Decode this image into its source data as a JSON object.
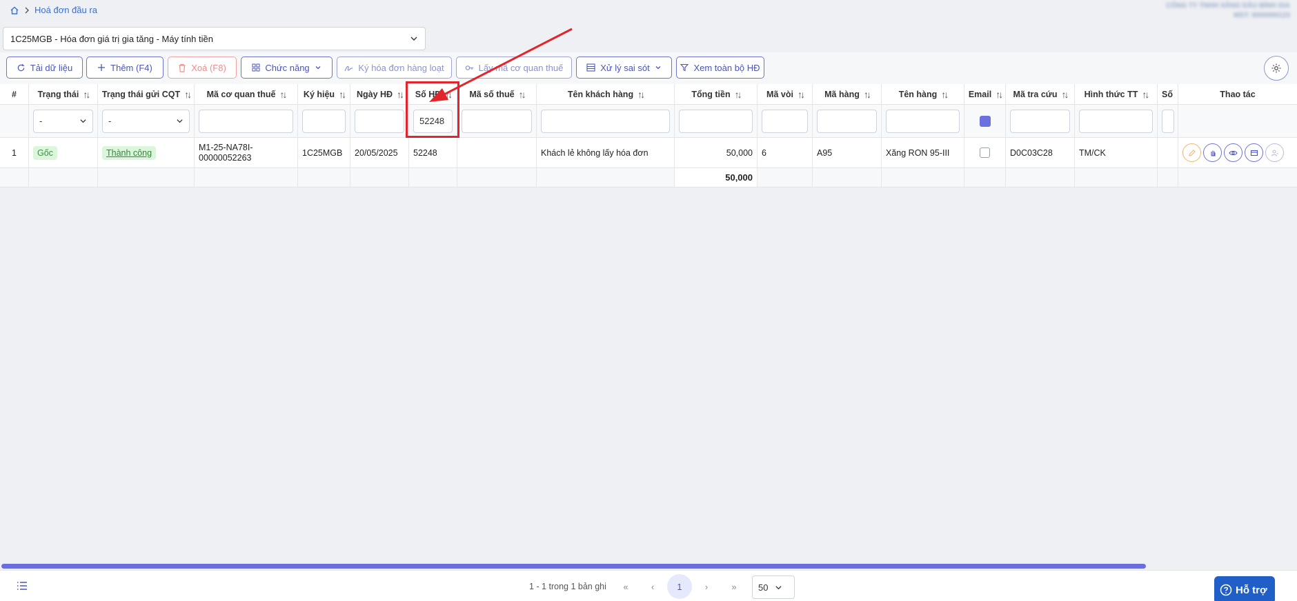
{
  "breadcrumb": {
    "page": "Hoá đơn đầu ra"
  },
  "company": {
    "line1": "CÔNG TY TNHH XĂNG DẦU BÌNH GIA",
    "line2": "MST: 0000000123"
  },
  "series_select": {
    "value": "1C25MGB - Hóa đơn giá trị gia tăng - Máy tính tiền"
  },
  "toolbar": {
    "reload": "Tải dữ liệu",
    "add": "Thêm (F4)",
    "delete": "Xoá (F8)",
    "functions": "Chức năng",
    "bulk_sign": "Ký hóa đơn hàng loạt",
    "get_tax_code": "Lấy mã cơ quan thuế",
    "handle_errors": "Xử lý sai sót",
    "view_all": "Xem toàn bộ HĐ"
  },
  "columns": {
    "index": "#",
    "status": "Trạng thái",
    "send_status": "Trạng thái gửi CQT",
    "tax_authority_code": "Mã cơ quan thuế",
    "symbol": "Ký hiệu",
    "date": "Ngày HĐ",
    "invoice_no": "Số HĐ",
    "tax_id": "Mã số thuế",
    "customer_name": "Tên khách hàng",
    "total": "Tổng tiền",
    "nozzle": "Mã vòi",
    "item_code": "Mã hàng",
    "item_name": "Tên hàng",
    "email": "Email",
    "lookup_code": "Mã tra cứu",
    "payment": "Hình thức TT",
    "extra": "Số",
    "actions": "Thao tác"
  },
  "filters": {
    "status": "-",
    "send_status": "-",
    "invoice_no": "52248"
  },
  "rows": [
    {
      "index": "1",
      "status": "Gốc",
      "send_status": "Thành công",
      "tax_authority_code_1": "M1-25-NA78I-",
      "tax_authority_code_2": "00000052263",
      "symbol": "1C25MGB",
      "date": "20/05/2025",
      "invoice_no": "52248",
      "tax_id": "",
      "customer_name": "Khách lẻ không lấy hóa đơn",
      "total": "50,000",
      "nozzle": "6",
      "item_code": "A95",
      "item_name": "Xăng RON 95-III",
      "lookup_code": "D0C03C28",
      "payment": "TM/CK"
    }
  ],
  "totals": {
    "total": "50,000"
  },
  "pagination": {
    "info": "1 - 1 trong 1 bản ghi",
    "current_page": "1",
    "page_size": "50"
  },
  "support": {
    "label": "Hỗ trợ"
  },
  "colors": {
    "accent": "#6d74c9",
    "highlight": "#e3242b",
    "success": "#2e9a3a"
  }
}
